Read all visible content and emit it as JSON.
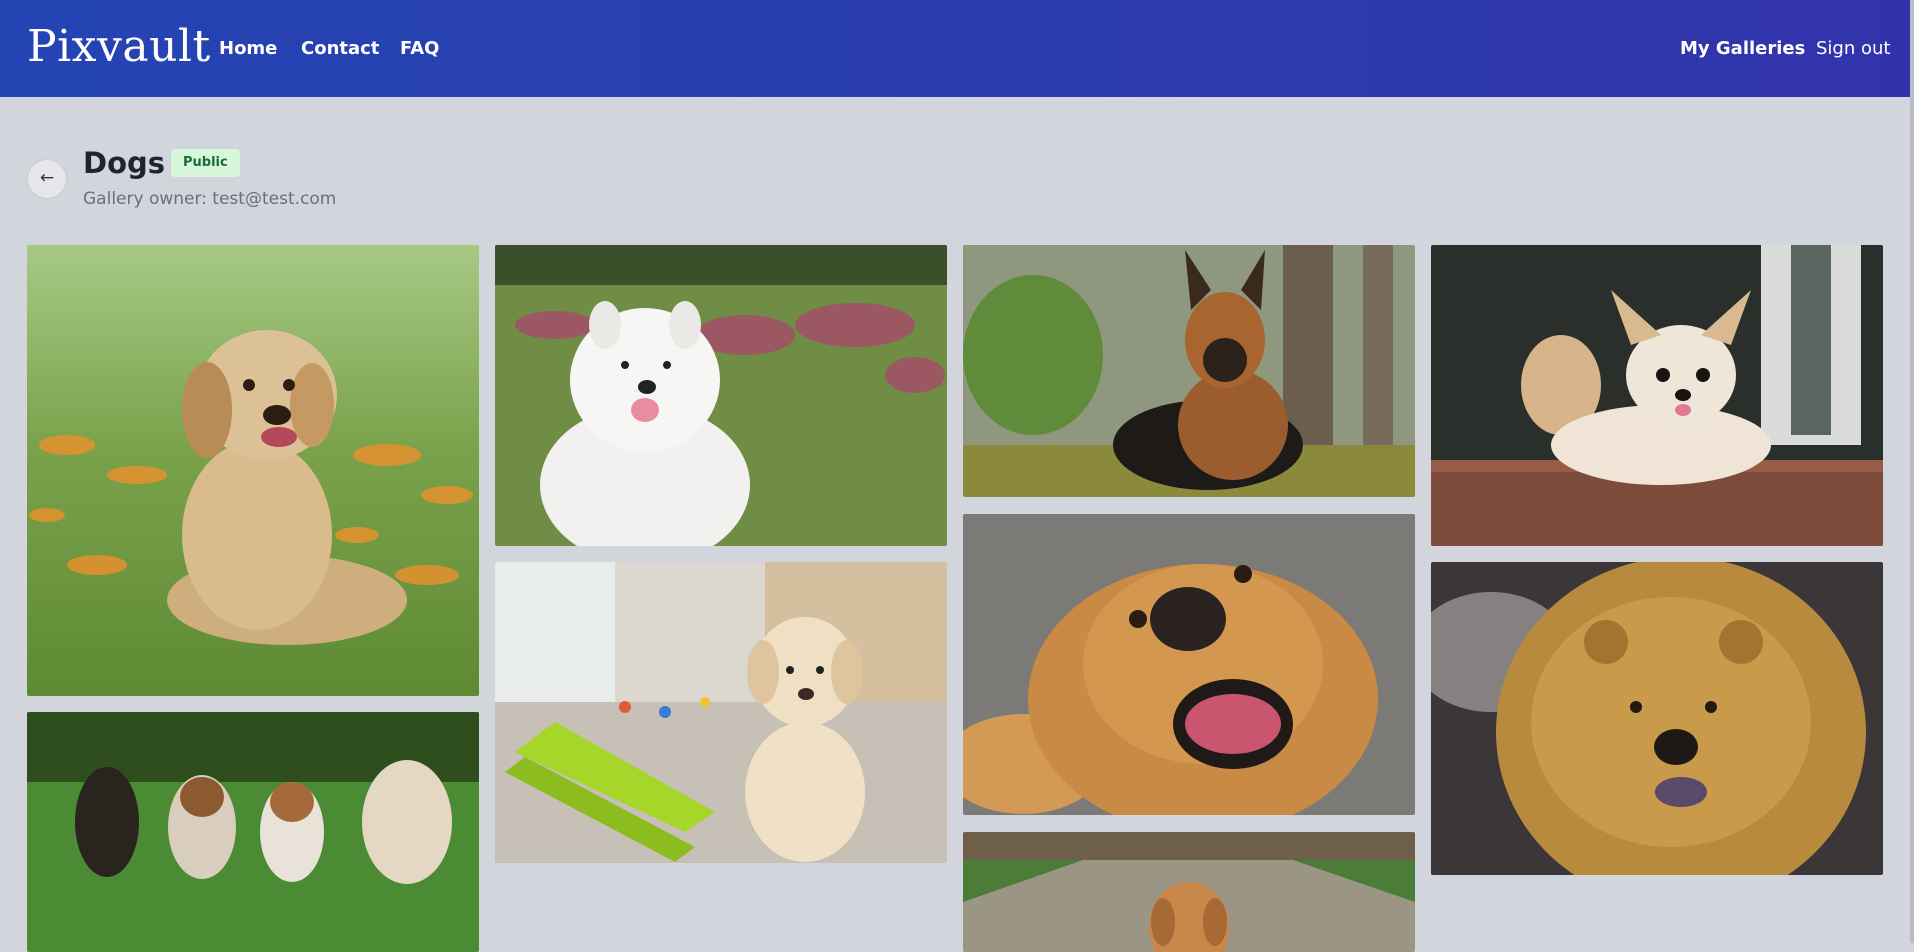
{
  "nav": {
    "brand": "Pixvault",
    "links": [
      "Home",
      "Contact",
      "FAQ"
    ],
    "my_galleries": "My Galleries",
    "sign_out": "Sign out"
  },
  "gallery": {
    "back_symbol": "←",
    "title": "Dogs",
    "visibility": "Public",
    "owner_line": "Gallery owner: test@test.com"
  },
  "photos": [
    {
      "name": "golden-puppy-in-flowers",
      "bg": "#7aa04a"
    },
    {
      "name": "samoyed-in-meadow",
      "bg": "#6e8b46"
    },
    {
      "name": "german-shepherd-in-forest",
      "bg": "#7d8a6a"
    },
    {
      "name": "chihuahua-on-porch",
      "bg": "#2c2f2e"
    },
    {
      "name": "four-dogs-running",
      "bg": "#4d8a32"
    },
    {
      "name": "labrador-puppy-indoors",
      "bg": "#d4d0c7"
    },
    {
      "name": "golden-retriever-closeup",
      "bg": "#7a7874"
    },
    {
      "name": "chow-chow-portrait",
      "bg": "#3a3536"
    },
    {
      "name": "golden-puppy-on-path",
      "bg": "#8c8a7c"
    }
  ]
}
